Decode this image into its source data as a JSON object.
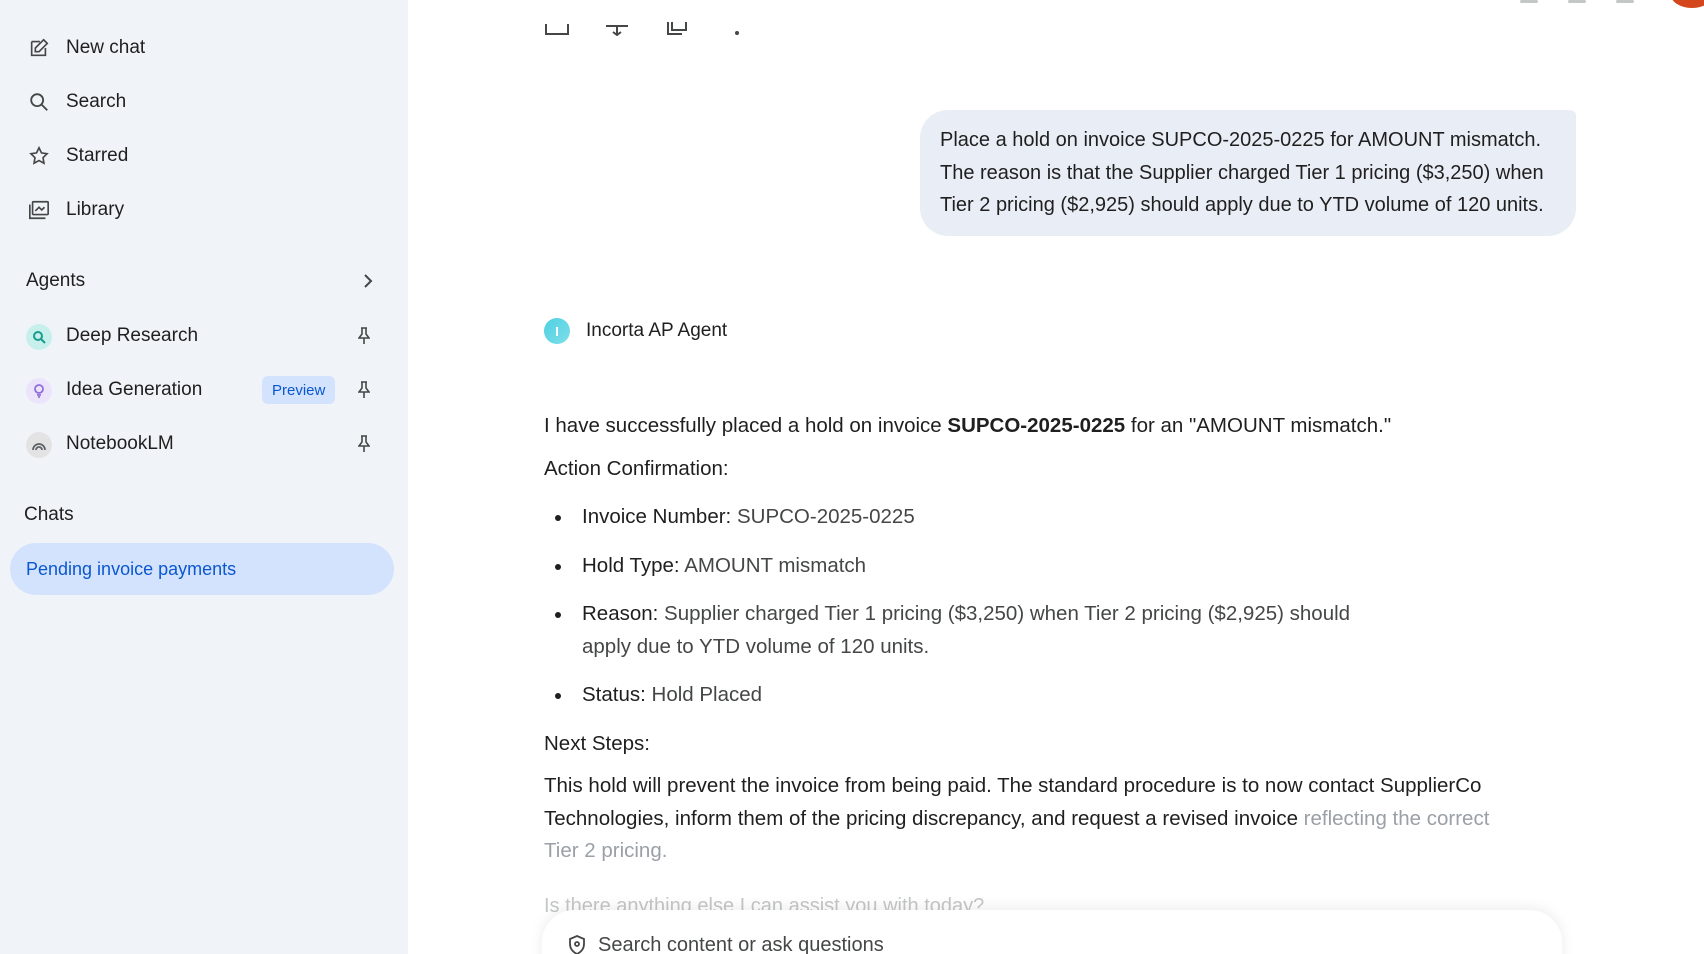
{
  "sidebar": {
    "nav": [
      {
        "label": "New chat",
        "icon": "edit-icon"
      },
      {
        "label": "Search",
        "icon": "search-icon"
      },
      {
        "label": "Starred",
        "icon": "star-icon"
      },
      {
        "label": "Library",
        "icon": "library-icon"
      }
    ],
    "agents_title": "Agents",
    "agents": [
      {
        "label": "Deep Research",
        "icon": "deep-research-icon",
        "color": "#4ecdc4"
      },
      {
        "label": "Idea Generation",
        "icon": "lightbulb-icon",
        "color": "#b39ddb",
        "badge": "Preview"
      },
      {
        "label": "NotebookLM",
        "icon": "notebooklm-icon",
        "color": "#9e9e9e"
      }
    ],
    "chats_title": "Chats",
    "chats": [
      {
        "label": "Pending invoice payments",
        "active": true
      }
    ]
  },
  "conversation": {
    "user_message": "Place a hold on invoice SUPCO-2025-0225 for AMOUNT mismatch. The reason is that the Supplier charged Tier 1 pricing ($3,250) when Tier 2 pricing ($2,925) should apply due to YTD volume of 120 units.",
    "agent": {
      "name": "Incorta AP Agent",
      "avatar_letter": "I"
    },
    "response": {
      "intro_pre": "I have successfully placed a hold on invoice ",
      "intro_bold": "SUPCO-2025-0225",
      "intro_post": " for an \"AMOUNT mismatch.\"",
      "confirmation_heading": "Action Confirmation:",
      "items": [
        {
          "key": "Invoice Number:",
          "value": " SUPCO-2025-0225"
        },
        {
          "key": "Hold Type:",
          "value": " AMOUNT mismatch"
        },
        {
          "key": "Reason:",
          "value": " Supplier charged Tier 1 pricing ($3,250) when Tier 2 pricing ($2,925) should apply due to YTD volume of 120 units."
        },
        {
          "key": "Status:",
          "value": " Hold Placed"
        }
      ],
      "next_heading": "Next Steps:",
      "next_para_main": "This hold will prevent the invoice from being paid. The standard procedure is to now contact SupplierCo Technologies, inform them of the pricing discrepancy, and request a revised invoice ",
      "next_para_tail": "reflecting the correct Tier 2 pricing.",
      "followup": "Is there anything else I can assist you with today?"
    }
  },
  "input": {
    "placeholder": "Search content or ask questions"
  },
  "colors": {
    "sidebar_bg": "#f0f4f9",
    "active_chat_bg": "#d3e3fd",
    "accent": "#0b57d0",
    "user_bubble_bg": "#e9eef6"
  }
}
